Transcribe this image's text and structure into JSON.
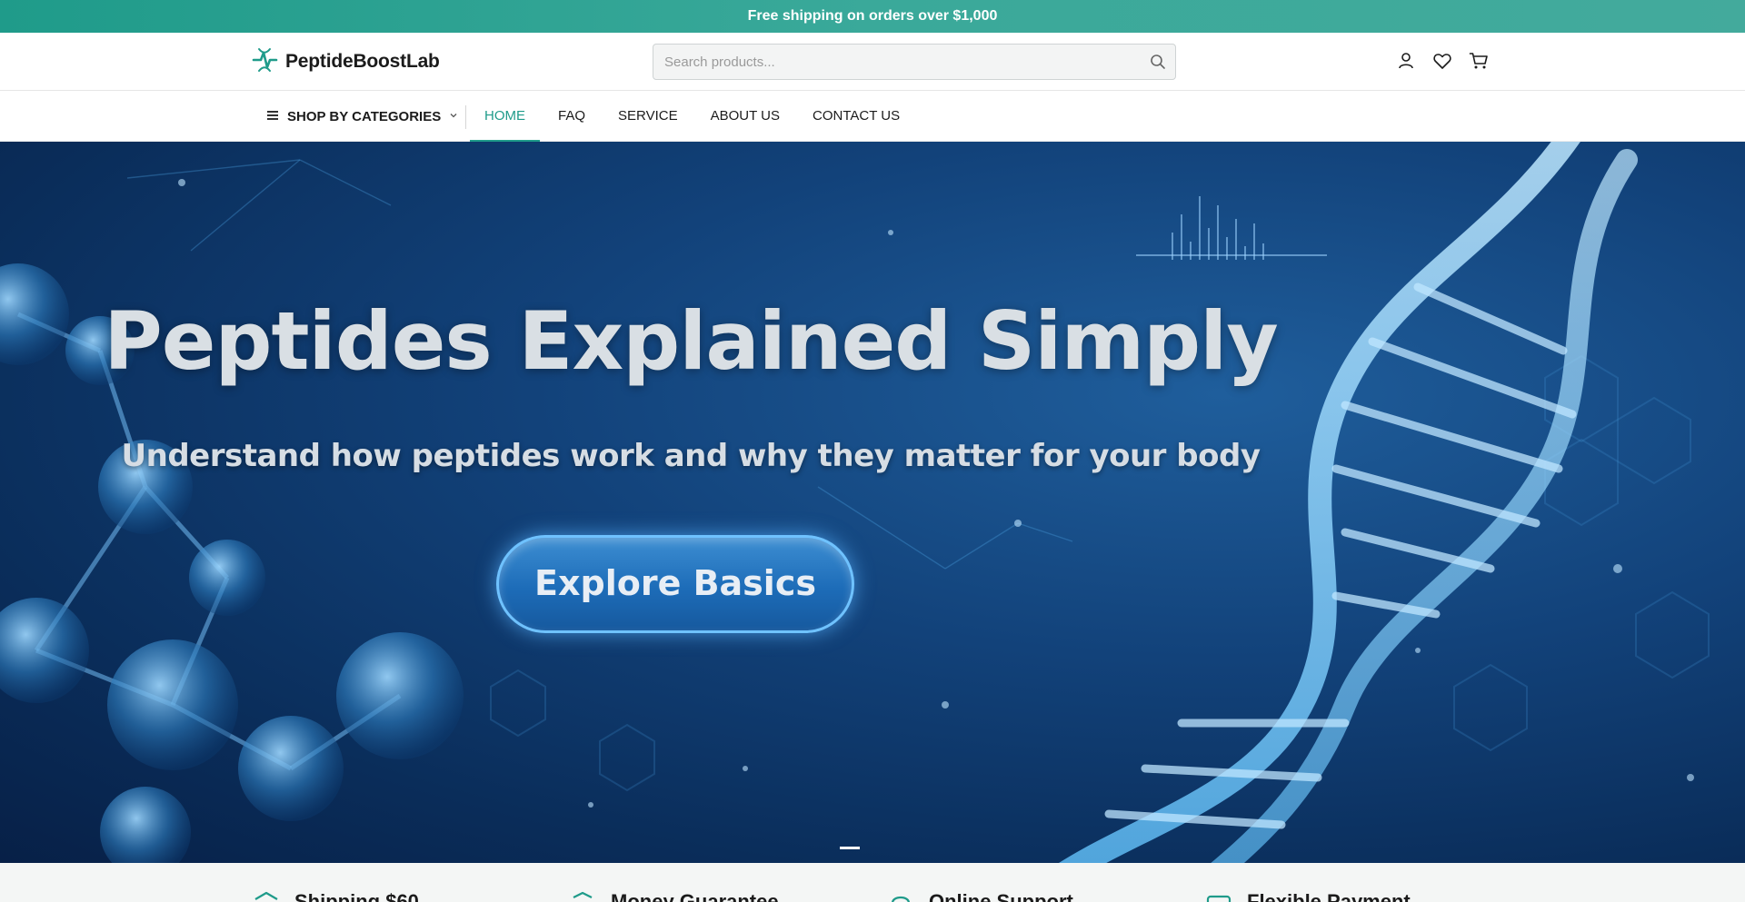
{
  "announcement": "Free shipping on orders over $1,000",
  "brand": {
    "name": "PeptideBoostLab",
    "accent": "#1f9b8a"
  },
  "search": {
    "placeholder": "Search products..."
  },
  "header_icons": [
    "user-icon",
    "heart-icon",
    "cart-icon"
  ],
  "nav": {
    "categories_label": "SHOP BY CATEGORIES",
    "links": [
      {
        "label": "HOME",
        "active": true
      },
      {
        "label": "FAQ"
      },
      {
        "label": "SERVICE"
      },
      {
        "label": "ABOUT US"
      },
      {
        "label": "CONTACT US"
      }
    ]
  },
  "hero": {
    "title": "Peptides Explained Simply",
    "subtitle": "Understand how peptides work and why they matter for your body",
    "button": "Explore Basics",
    "slides": 3,
    "active_slide": 1
  },
  "features": [
    {
      "title": "Shipping $60",
      "icon": "truck-icon"
    },
    {
      "title": "Money Guarantee",
      "icon": "shield-icon"
    },
    {
      "title": "Online Support",
      "icon": "headset-icon"
    },
    {
      "title": "Flexible Payment",
      "icon": "card-icon"
    }
  ]
}
